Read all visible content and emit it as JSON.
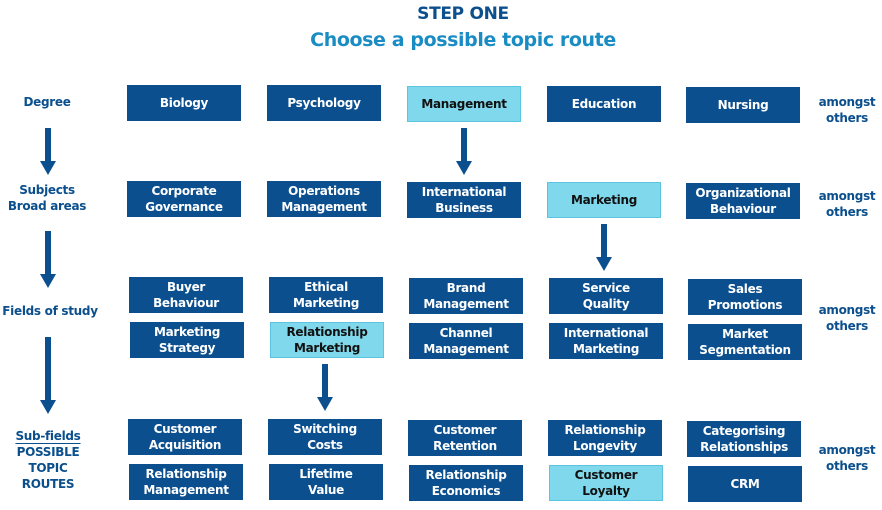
{
  "header": {
    "step": "STEP ONE",
    "subtitle": "Choose a possible topic route"
  },
  "colors": {
    "box": "#0b4f8f",
    "highlight": "#7fd8ec",
    "label": "#0b4f8c",
    "subtitle": "#1a8cc4"
  },
  "levels": [
    {
      "label": "Degree"
    },
    {
      "label": "Subjects\nBroad areas"
    },
    {
      "label": "Fields of study"
    },
    {
      "label_underlined": "Sub-fields",
      "label": "POSSIBLE\nTOPIC\nROUTES"
    }
  ],
  "amongst_others": "amongst\nothers",
  "degree": [
    {
      "text": "Biology",
      "highlighted": false
    },
    {
      "text": "Psychology",
      "highlighted": false
    },
    {
      "text": "Management",
      "highlighted": true
    },
    {
      "text": "Education",
      "highlighted": false
    },
    {
      "text": "Nursing",
      "highlighted": false
    }
  ],
  "subjects": [
    {
      "text": "Corporate\nGovernance",
      "highlighted": false
    },
    {
      "text": "Operations\nManagement",
      "highlighted": false
    },
    {
      "text": "International\nBusiness",
      "highlighted": false
    },
    {
      "text": "Marketing",
      "highlighted": true
    },
    {
      "text": "Organizational\nBehaviour",
      "highlighted": false
    }
  ],
  "fields_row1": [
    {
      "text": "Buyer\nBehaviour",
      "highlighted": false
    },
    {
      "text": "Ethical\nMarketing",
      "highlighted": false
    },
    {
      "text": "Brand\nManagement",
      "highlighted": false
    },
    {
      "text": "Service\nQuality",
      "highlighted": false
    },
    {
      "text": "Sales\nPromotions",
      "highlighted": false
    }
  ],
  "fields_row2": [
    {
      "text": "Marketing\nStrategy",
      "highlighted": false
    },
    {
      "text": "Relationship\nMarketing",
      "highlighted": true
    },
    {
      "text": "Channel\nManagement",
      "highlighted": false
    },
    {
      "text": "International\nMarketing",
      "highlighted": false
    },
    {
      "text": "Market\nSegmentation",
      "highlighted": false
    }
  ],
  "subfields_row1": [
    {
      "text": "Customer\nAcquisition",
      "highlighted": false
    },
    {
      "text": "Switching\nCosts",
      "highlighted": false
    },
    {
      "text": "Customer\nRetention",
      "highlighted": false
    },
    {
      "text": "Relationship\nLongevity",
      "highlighted": false
    },
    {
      "text": "Categorising\nRelationships",
      "highlighted": false
    }
  ],
  "subfields_row2": [
    {
      "text": "Relationship\nManagement",
      "highlighted": false
    },
    {
      "text": "Lifetime\nValue",
      "highlighted": false
    },
    {
      "text": "Relationship\nEconomics",
      "highlighted": false
    },
    {
      "text": "Customer\nLoyalty",
      "highlighted": true
    },
    {
      "text": "CRM",
      "highlighted": false
    }
  ]
}
